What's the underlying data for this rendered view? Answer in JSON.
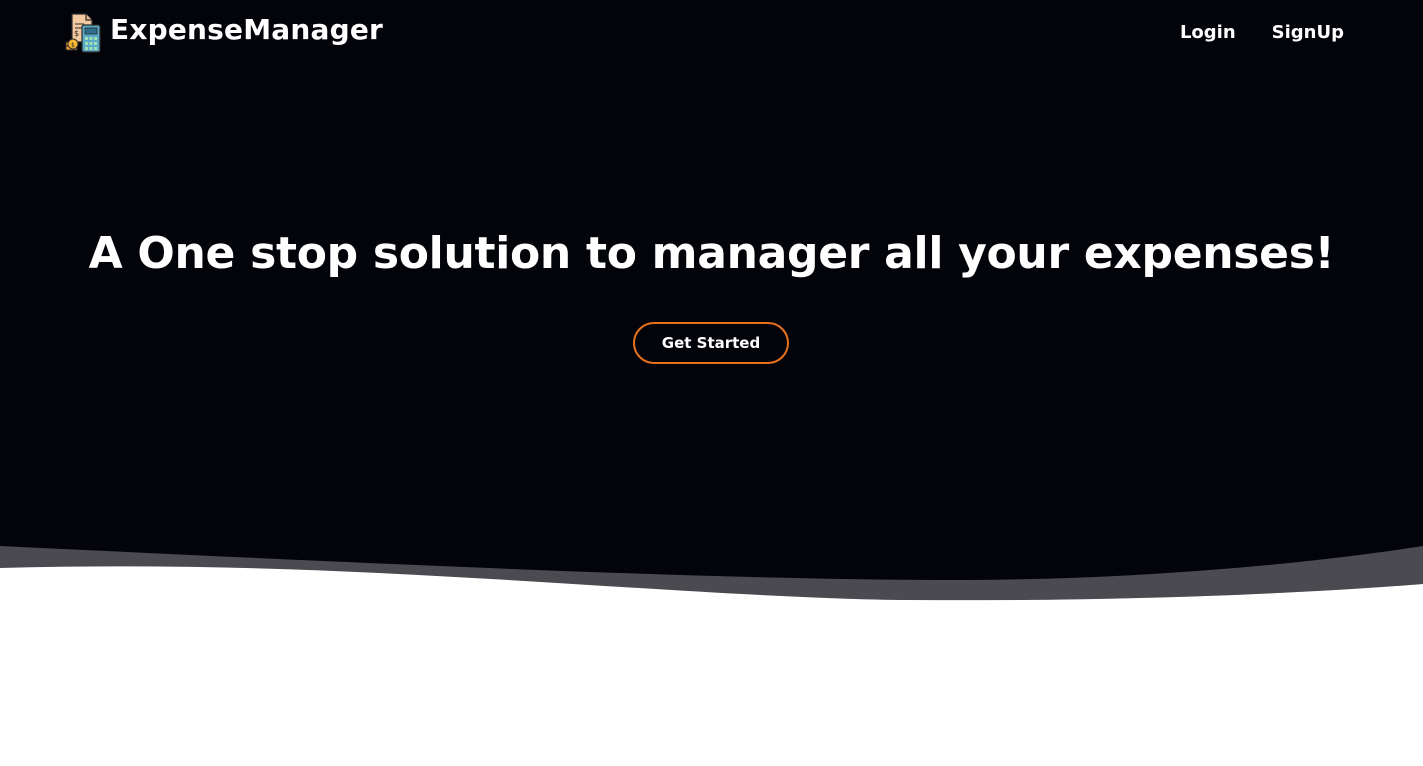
{
  "navbar": {
    "brand_name": "ExpenseManager",
    "brand_icon": "calculator-invoice-icon",
    "links": [
      {
        "label": "Login"
      },
      {
        "label": "SignUp"
      }
    ]
  },
  "hero": {
    "headline": "A One stop solution to manager all your expenses!",
    "cta_label": "Get Started"
  },
  "colors": {
    "hero_background": "#03040a",
    "wave_gray": "#4a4a50",
    "accent_orange": "#e8711d",
    "text_white": "#ffffff",
    "page_background": "#ffffff"
  }
}
